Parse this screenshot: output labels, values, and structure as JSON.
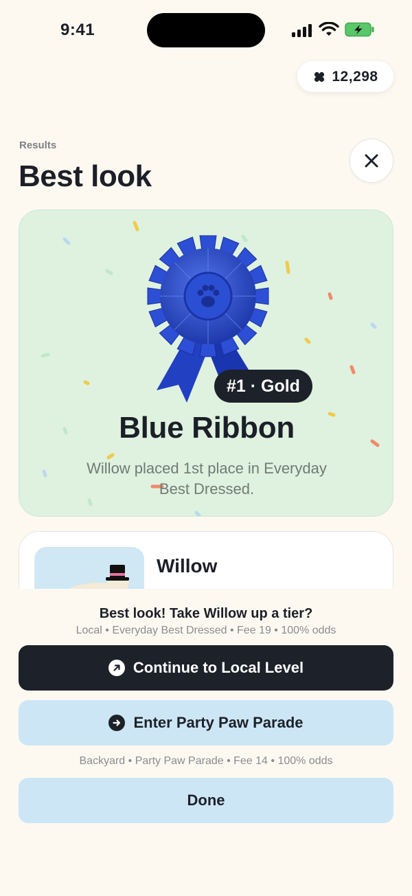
{
  "status_bar": {
    "time": "9:41"
  },
  "coins": {
    "amount": "12,298",
    "icon": "paw-coin-icon"
  },
  "header": {
    "eyebrow": "Results",
    "title": "Best look"
  },
  "award": {
    "rank_label": "#1 · Gold",
    "title": "Blue Ribbon",
    "description": "Willow placed 1st place in Everyday Best Dressed.",
    "ribbon_color": "#2746c9",
    "card_color": "#def2df"
  },
  "pet": {
    "name": "Willow"
  },
  "prompt": {
    "title": "Best look! Take Willow up a tier?",
    "meta": "Local • Everyday Best Dressed • Fee 19 • 100% odds"
  },
  "actions": {
    "continue_label": "Continue to Local Level",
    "enter_label": "Enter Party Paw Parade",
    "enter_meta": "Backyard • Party Paw Parade • Fee 14 • 100% odds",
    "done_label": "Done"
  }
}
